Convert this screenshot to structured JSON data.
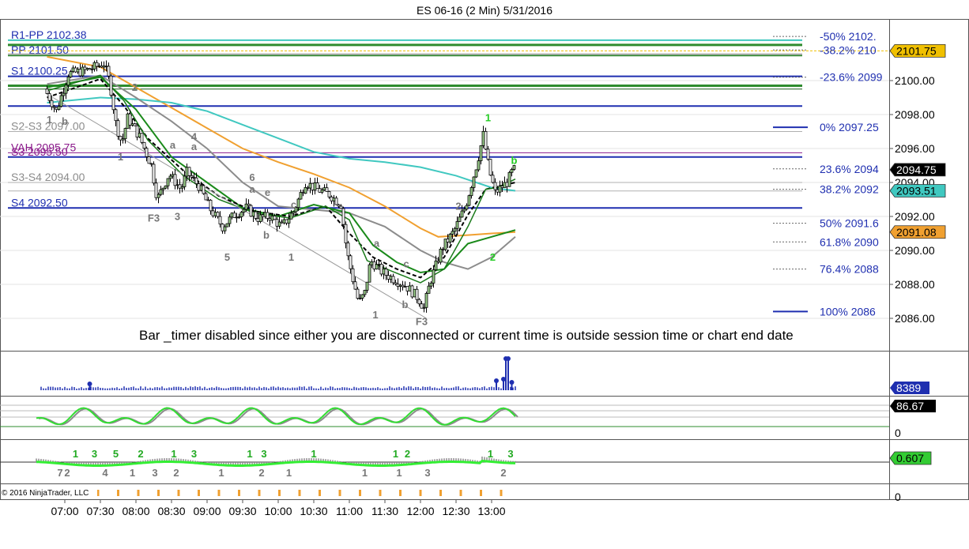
{
  "title": "ES 06-16 (2 Min)  5/31/2016",
  "copyright": "© 2016 NinjaTrader, LLC",
  "status_message": "Bar _timer disabled since either you are disconnected or current time is outside session time or chart end date",
  "colors": {
    "up_candle": "#9acd8a",
    "down_candle": "#ffffff",
    "fast_ma": "#1a8a1a",
    "dash_ma": "#000000",
    "gray_ma": "#8c8c8c",
    "cyan_ma": "#40c8c0",
    "orange_ma": "#f0a030",
    "pivot_blue": "#1f2fb0",
    "pivot_green": "#2e8b2e"
  },
  "chart_data": [
    {
      "type": "candlestick",
      "title": "ES 06-16 (2 Min)  5/31/2016",
      "x_ticks": [
        "07:00",
        "07:30",
        "08:00",
        "08:30",
        "09:00",
        "09:30",
        "10:00",
        "10:30",
        "11:00",
        "11:30",
        "12:00",
        "12:30",
        "13:00"
      ],
      "y_ticks": [
        "2086.00",
        "2088.00",
        "2090.00",
        "2092.00",
        "2094.00",
        "2096.00",
        "2098.00",
        "2100.00"
      ],
      "ylim": [
        2084.7,
        2102.8
      ],
      "price_path": [
        [
          "06:45",
          2099.5
        ],
        [
          "06:55",
          2098.2
        ],
        [
          "07:05",
          2100.4
        ],
        [
          "07:20",
          2100.6
        ],
        [
          "07:35",
          2101.0
        ],
        [
          "07:40",
          2099.9
        ],
        [
          "07:45",
          2097.5
        ],
        [
          "07:50",
          2096.3
        ],
        [
          "07:55",
          2097.8
        ],
        [
          "08:05",
          2096.7
        ],
        [
          "08:15",
          2095.0
        ],
        [
          "08:20",
          2093.0
        ],
        [
          "08:30",
          2094.5
        ],
        [
          "08:40",
          2093.6
        ],
        [
          "08:45",
          2094.6
        ],
        [
          "08:55",
          2093.8
        ],
        [
          "09:05",
          2092.4
        ],
        [
          "09:15",
          2091.4
        ],
        [
          "09:25",
          2092.1
        ],
        [
          "09:35",
          2092.5
        ],
        [
          "09:45",
          2091.9
        ],
        [
          "09:55",
          2092.0
        ],
        [
          "10:05",
          2091.4
        ],
        [
          "10:15",
          2092.3
        ],
        [
          "10:25",
          2094.0
        ],
        [
          "10:35",
          2093.6
        ],
        [
          "10:45",
          2093.3
        ],
        [
          "10:55",
          2092.7
        ],
        [
          "11:00",
          2089.9
        ],
        [
          "11:05",
          2088.3
        ],
        [
          "11:10",
          2086.9
        ],
        [
          "11:15",
          2087.5
        ],
        [
          "11:20",
          2089.4
        ],
        [
          "11:30",
          2088.7
        ],
        [
          "11:40",
          2088.3
        ],
        [
          "11:50",
          2087.9
        ],
        [
          "12:00",
          2087.2
        ],
        [
          "12:05",
          2086.6
        ],
        [
          "12:10",
          2088.1
        ],
        [
          "12:20",
          2090.1
        ],
        [
          "12:30",
          2091.1
        ],
        [
          "12:40",
          2092.6
        ],
        [
          "12:50",
          2095.2
        ],
        [
          "12:55",
          2096.8
        ],
        [
          "13:00",
          2094.7
        ],
        [
          "13:05",
          2093.4
        ],
        [
          "13:15",
          2094.0
        ],
        [
          "13:20",
          2094.75
        ]
      ],
      "moving_averages": [
        {
          "name": "fast",
          "points": [
            [
              "06:45",
              2099.4
            ],
            [
              "07:30",
              2100.3
            ],
            [
              "07:50",
              2098.8
            ],
            [
              "08:10",
              2096.5
            ],
            [
              "08:40",
              2094.4
            ],
            [
              "09:10",
              2093.0
            ],
            [
              "09:40",
              2092.2
            ],
            [
              "10:10",
              2091.9
            ],
            [
              "10:40",
              2092.6
            ],
            [
              "11:00",
              2091.8
            ],
            [
              "11:15",
              2089.4
            ],
            [
              "11:35",
              2088.8
            ],
            [
              "12:00",
              2088.1
            ],
            [
              "12:20",
              2088.9
            ],
            [
              "12:40",
              2091.4
            ],
            [
              "12:55",
              2093.6
            ],
            [
              "13:05",
              2093.7
            ],
            [
              "13:20",
              2094.2
            ]
          ]
        },
        {
          "name": "dashed",
          "points": [
            [
              "06:45",
              2099.0
            ],
            [
              "07:30",
              2100.1
            ],
            [
              "07:50",
              2098.5
            ],
            [
              "08:10",
              2096.6
            ],
            [
              "08:40",
              2094.7
            ],
            [
              "09:10",
              2093.2
            ],
            [
              "09:40",
              2092.3
            ],
            [
              "10:10",
              2092.0
            ],
            [
              "10:40",
              2092.6
            ],
            [
              "11:00",
              2091.0
            ],
            [
              "11:20",
              2089.6
            ],
            [
              "11:40",
              2088.9
            ],
            [
              "12:00",
              2088.4
            ],
            [
              "12:20",
              2089.6
            ],
            [
              "12:40",
              2092.1
            ],
            [
              "12:55",
              2093.6
            ],
            [
              "13:20",
              2094.0
            ]
          ]
        },
        {
          "name": "slow-green",
          "points": [
            [
              "06:45",
              2099.6
            ],
            [
              "07:30",
              2100.2
            ],
            [
              "08:00",
              2098.3
            ],
            [
              "08:30",
              2095.5
            ],
            [
              "09:00",
              2094.0
            ],
            [
              "09:30",
              2092.5
            ],
            [
              "10:00",
              2092.0
            ],
            [
              "10:30",
              2092.7
            ],
            [
              "11:00",
              2092.2
            ],
            [
              "11:20",
              2090.3
            ],
            [
              "11:40",
              2089.3
            ],
            [
              "12:00",
              2088.7
            ],
            [
              "12:20",
              2088.9
            ],
            [
              "12:40",
              2090.4
            ],
            [
              "13:00",
              2090.8
            ],
            [
              "13:20",
              2091.2
            ]
          ]
        },
        {
          "name": "gray",
          "points": [
            [
              "06:45",
              2099.8
            ],
            [
              "07:30",
              2100.3
            ],
            [
              "08:00",
              2099.0
            ],
            [
              "08:30",
              2097.6
            ],
            [
              "09:00",
              2096.0
            ],
            [
              "09:30",
              2094.0
            ],
            [
              "10:00",
              2092.6
            ],
            [
              "10:30",
              2092.4
            ],
            [
              "11:00",
              2092.2
            ],
            [
              "11:30",
              2091.4
            ],
            [
              "12:00",
              2090.0
            ],
            [
              "12:20",
              2089.3
            ],
            [
              "12:40",
              2088.9
            ],
            [
              "13:00",
              2089.6
            ],
            [
              "13:20",
              2090.8
            ]
          ]
        },
        {
          "name": "cyan",
          "points": [
            [
              "06:45",
              2098.7
            ],
            [
              "07:30",
              2099.0
            ],
            [
              "08:00",
              2098.9
            ],
            [
              "08:30",
              2098.7
            ],
            [
              "09:00",
              2098.2
            ],
            [
              "09:30",
              2097.4
            ],
            [
              "10:00",
              2096.6
            ],
            [
              "10:30",
              2095.8
            ],
            [
              "11:00",
              2095.4
            ],
            [
              "11:30",
              2095.2
            ],
            [
              "12:00",
              2094.9
            ],
            [
              "12:30",
              2094.4
            ],
            [
              "13:00",
              2093.7
            ],
            [
              "13:20",
              2093.51
            ]
          ]
        },
        {
          "name": "orange",
          "points": [
            [
              "06:45",
              2101.4
            ],
            [
              "07:30",
              2100.8
            ],
            [
              "08:00",
              2099.6
            ],
            [
              "08:30",
              2098.4
            ],
            [
              "09:00",
              2097.2
            ],
            [
              "09:30",
              2096.0
            ],
            [
              "10:00",
              2095.2
            ],
            [
              "10:30",
              2094.5
            ],
            [
              "11:00",
              2093.7
            ],
            [
              "11:30",
              2092.6
            ],
            [
              "12:00",
              2091.3
            ],
            [
              "12:15",
              2090.8
            ],
            [
              "12:40",
              2090.9
            ],
            [
              "13:00",
              2091.0
            ],
            [
              "13:20",
              2091.08
            ]
          ]
        }
      ],
      "price_levels": [
        {
          "label": "R1-PP 2102.38",
          "value": 2102.38
        },
        {
          "label": "PP 2101.50",
          "value": 2101.5
        },
        {
          "label": "S1 2100.25",
          "value": 2100.25
        },
        {
          "label": "S2-S3 2097.00",
          "value": 2097.0
        },
        {
          "label": "VAH 2095.75",
          "value": 2095.75
        },
        {
          "label": "S3 2095.50",
          "value": 2095.5
        },
        {
          "label": "S3-S4 2094.00",
          "value": 2094.0
        },
        {
          "label": "S4 2092.50",
          "value": 2092.5
        }
      ],
      "fib_levels": [
        {
          "label": "-50%  2102.",
          "value": 2102.6
        },
        {
          "label": "-38.2%  210",
          "value": 2101.8
        },
        {
          "label": "-23.6%  2099",
          "value": 2100.2
        },
        {
          "label": "0%  2097.25",
          "value": 2097.25
        },
        {
          "label": "23.6%  2094",
          "value": 2094.8
        },
        {
          "label": "38.2%  2092",
          "value": 2093.6
        },
        {
          "label": "50%  2091.6",
          "value": 2091.6
        },
        {
          "label": "61.8%  2090",
          "value": 2090.5
        },
        {
          "label": "76.4%  2088",
          "value": 2088.9
        },
        {
          "label": "100%  2086",
          "value": 2086.4
        }
      ],
      "price_badges": [
        {
          "label": "2101.75",
          "value": 2101.75,
          "color": "#f0c000"
        },
        {
          "label": "2094.75",
          "value": 2094.75,
          "color": "#000000"
        },
        {
          "label": "2093.51",
          "value": 2093.51,
          "color": "#40c8c0"
        },
        {
          "label": "2091.08",
          "value": 2091.08,
          "color": "#f0a030"
        }
      ],
      "wave_labels": [
        {
          "t": "1",
          "time": "06:47",
          "value": 2097.5
        },
        {
          "t": "b",
          "time": "07:00",
          "value": 2097.4
        },
        {
          "t": "1",
          "time": "07:47",
          "value": 2095.3
        },
        {
          "t": "2",
          "time": "07:59",
          "value": 2099.4
        },
        {
          "t": "a",
          "time": "08:31",
          "value": 2096.0
        },
        {
          "t": "4",
          "time": "08:49",
          "value": 2096.5
        },
        {
          "t": "a",
          "time": "08:49",
          "value": 2095.9
        },
        {
          "t": "F3",
          "time": "08:15",
          "value": 2091.7
        },
        {
          "t": "3",
          "time": "08:35",
          "value": 2091.8
        },
        {
          "t": "6",
          "time": "09:38",
          "value": 2094.1
        },
        {
          "t": "a",
          "time": "09:38",
          "value": 2093.4
        },
        {
          "t": "e",
          "time": "09:51",
          "value": 2093.2
        },
        {
          "t": "c",
          "time": "10:13",
          "value": 2092.5
        },
        {
          "t": "5",
          "time": "09:17",
          "value": 2089.4
        },
        {
          "t": "b",
          "time": "09:50",
          "value": 2090.7
        },
        {
          "t": "1",
          "time": "10:11",
          "value": 2089.4
        },
        {
          "t": "a",
          "time": "11:23",
          "value": 2090.2
        },
        {
          "t": "c",
          "time": "11:48",
          "value": 2089.0
        },
        {
          "t": "1",
          "time": "11:22",
          "value": 2086.0
        },
        {
          "t": "b",
          "time": "11:47",
          "value": 2086.6
        },
        {
          "t": "F3",
          "time": "12:01",
          "value": 2085.6
        },
        {
          "t": "2",
          "time": "12:32",
          "value": 2092.4
        },
        {
          "t": "1",
          "time": "12:57",
          "value": 2097.6
        },
        {
          "t": "b",
          "time": "13:19",
          "value": 2095.1
        },
        {
          "t": "2",
          "time": "13:01",
          "value": 2089.4
        }
      ]
    },
    {
      "type": "bar",
      "panel": "volume",
      "y_ticks": [],
      "last_value": "8389"
    },
    {
      "type": "line",
      "panel": "stochastic",
      "y_ticks": [
        "0"
      ],
      "last_value": "86.67"
    },
    {
      "type": "histogram",
      "panel": "momentum",
      "y_ticks": [
        "0"
      ],
      "last_value": "0.607",
      "count_labels": [
        {
          "t": "7",
          "time": "06:56",
          "pos": "below"
        },
        {
          "t": "1",
          "time": "07:09",
          "pos": "above"
        },
        {
          "t": "2",
          "time": "07:02",
          "pos": "below"
        },
        {
          "t": "3",
          "time": "07:25",
          "pos": "above"
        },
        {
          "t": "4",
          "time": "07:34",
          "pos": "below"
        },
        {
          "t": "5",
          "time": "07:43",
          "pos": "above"
        },
        {
          "t": "1",
          "time": "07:57",
          "pos": "below"
        },
        {
          "t": "2",
          "time": "08:04",
          "pos": "above"
        },
        {
          "t": "3",
          "time": "08:16",
          "pos": "below"
        },
        {
          "t": "1",
          "time": "08:32",
          "pos": "above"
        },
        {
          "t": "2",
          "time": "08:34",
          "pos": "below"
        },
        {
          "t": "3",
          "time": "08:49",
          "pos": "above"
        },
        {
          "t": "1",
          "time": "09:12",
          "pos": "below"
        },
        {
          "t": "1",
          "time": "09:36",
          "pos": "above"
        },
        {
          "t": "3",
          "time": "09:48",
          "pos": "above"
        },
        {
          "t": "2",
          "time": "09:46",
          "pos": "below"
        },
        {
          "t": "1",
          "time": "10:09",
          "pos": "below"
        },
        {
          "t": "1",
          "time": "10:30",
          "pos": "above"
        },
        {
          "t": "1",
          "time": "11:13",
          "pos": "below"
        },
        {
          "t": "1",
          "time": "11:39",
          "pos": "above"
        },
        {
          "t": "2",
          "time": "11:49",
          "pos": "above"
        },
        {
          "t": "1",
          "time": "11:42",
          "pos": "below"
        },
        {
          "t": "3",
          "time": "12:06",
          "pos": "below"
        },
        {
          "t": "1",
          "time": "12:59",
          "pos": "above"
        },
        {
          "t": "3",
          "time": "13:16",
          "pos": "above"
        },
        {
          "t": "2",
          "time": "13:10",
          "pos": "below"
        }
      ]
    }
  ]
}
